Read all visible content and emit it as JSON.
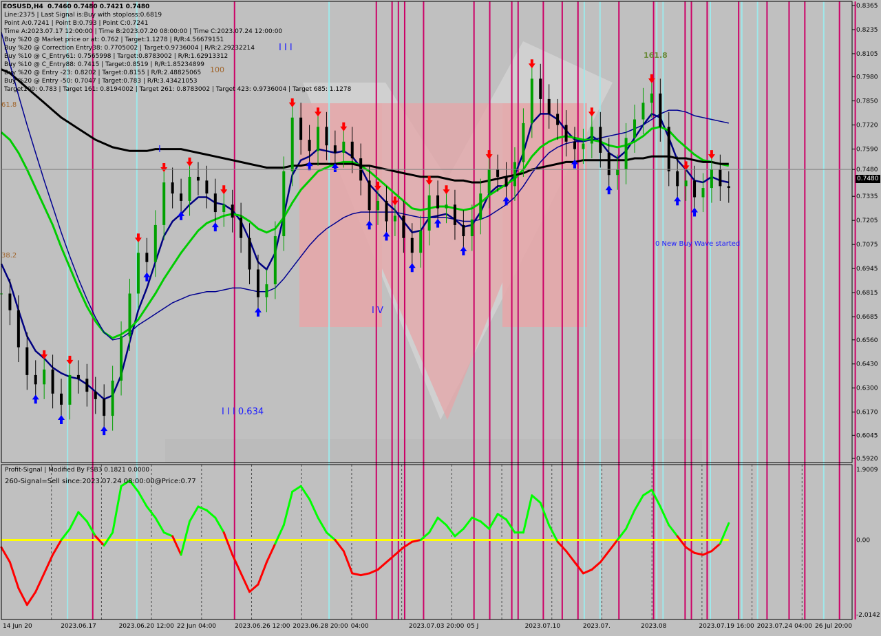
{
  "chart_data": {
    "type": "line",
    "symbol": "EOSUSD,H4",
    "ohlc": "0.7460 0.7480 0.7421 0.7480",
    "info_lines": [
      "Line:2375 | Last Signal is:Buy with stoploss:0.6819",
      "Point A:0.7241 | Point B:0.793 | Point C:0.7241",
      "Time A:2023.07.17 12:00:00 | Time B:2023.07.20 08:00:00 | Time C:2023.07.24 12:00:00",
      "Buy %20 @ Market price or at: 0.762 | Target:1.1278 | R/R:4.56679151",
      "Buy %20 @ Correction Entry38: 0.7705002 | Target:0.9736004 | R/R:2.29232214",
      "Buy %10 @ C_Entry61: 0.7565998 | Target:0.8783002 | R/R:1.62913312",
      "Buy %10 @ C_Entry88: 0.7415 | Target:0.8519 | R/R:1.85234899",
      "Buy %20 @ Entry -23: 0.8202 | Target:0.8155 | R/R:2.48825065",
      "Buy %20 @ Entry -50: 0.7047 | Target:0.783 | R/R:3.43421053",
      "Target100: 0.783 | Target 161: 0.8194002 | Target 261: 0.8783002 | Target 423: 0.9736004 | Target 685: 1.1278"
    ],
    "price_axis": {
      "ticks": [
        "0.8365",
        "0.8235",
        "0.8105",
        "0.7980",
        "0.7850",
        "0.7720",
        "0.7590",
        "0.7480",
        "0.7335",
        "0.7205",
        "0.7075",
        "0.6945",
        "0.6815",
        "0.6685",
        "0.6560",
        "0.6430",
        "0.6300",
        "0.6170",
        "0.6045",
        "0.5920"
      ],
      "min": 0.592,
      "max": 0.8365,
      "current": "0.7480"
    },
    "indicator": {
      "title": "Profit-Signal | Modified By FSB3 0.1821 0.0000",
      "signal_text": "260-Signal=Sell since:2023.07.24 08:00:00@Price:0.77",
      "axis_ticks": [
        "1.9009",
        "0.00",
        "-2.0142"
      ],
      "min": -2.0142,
      "max": 1.9009
    },
    "annotations": {
      "wave_labels": [
        "I",
        "I I I",
        "I V",
        "I I I 0.634"
      ],
      "fib_labels": [
        "61.8",
        "100",
        "38.2",
        "161.8"
      ],
      "status": "0 New Buy Wave started"
    },
    "time_labels": [
      "14 Jun 20",
      "2023.06.17",
      "2023.06.20 12:00",
      "22 Jun 04:00",
      "2023.06.26 12:00",
      "2023.06.28 20:00",
      "04:00",
      "2023.07.03 20:00",
      "05 J",
      "2023.07.10",
      "2023.07.",
      "2023.08",
      "2023.07.19 16:00",
      "2023.07.24 04:00",
      "26 Jul 20:00"
    ],
    "x_domain": [
      0,
      270
    ],
    "closes": [
      0.681,
      0.672,
      0.652,
      0.637,
      0.632,
      0.64,
      0.627,
      0.621,
      0.637,
      0.635,
      0.628,
      0.624,
      0.615,
      0.634,
      0.658,
      0.681,
      0.703,
      0.698,
      0.718,
      0.741,
      0.735,
      0.731,
      0.744,
      0.742,
      0.735,
      0.725,
      0.729,
      0.722,
      0.711,
      0.694,
      0.679,
      0.686,
      0.712,
      0.747,
      0.776,
      0.764,
      0.758,
      0.771,
      0.761,
      0.757,
      0.763,
      0.754,
      0.742,
      0.726,
      0.731,
      0.72,
      0.723,
      0.711,
      0.703,
      0.715,
      0.734,
      0.727,
      0.729,
      0.718,
      0.712,
      0.721,
      0.735,
      0.748,
      0.744,
      0.739,
      0.752,
      0.773,
      0.797,
      0.786,
      0.778,
      0.772,
      0.763,
      0.759,
      0.762,
      0.771,
      0.757,
      0.745,
      0.748,
      0.765,
      0.775,
      0.784,
      0.789,
      0.771,
      0.747,
      0.739,
      0.742,
      0.733,
      0.738,
      0.748,
      0.739,
      0.738
    ],
    "series": [
      {
        "name": "",
        "color": "#000080",
        "values": [
          0.697,
          0.687,
          0.672,
          0.658,
          0.65,
          0.646,
          0.641,
          0.638,
          0.636,
          0.635,
          0.632,
          0.628,
          0.624,
          0.626,
          0.637,
          0.655,
          0.672,
          0.684,
          0.698,
          0.712,
          0.72,
          0.724,
          0.729,
          0.733,
          0.733,
          0.73,
          0.729,
          0.726,
          0.72,
          0.71,
          0.698,
          0.694,
          0.703,
          0.723,
          0.745,
          0.753,
          0.755,
          0.759,
          0.758,
          0.757,
          0.758,
          0.755,
          0.749,
          0.74,
          0.735,
          0.73,
          0.726,
          0.72,
          0.714,
          0.715,
          0.722,
          0.723,
          0.724,
          0.721,
          0.717,
          0.718,
          0.725,
          0.735,
          0.739,
          0.739,
          0.745,
          0.757,
          0.773,
          0.778,
          0.778,
          0.775,
          0.769,
          0.764,
          0.763,
          0.766,
          0.763,
          0.757,
          0.754,
          0.758,
          0.765,
          0.772,
          0.778,
          0.776,
          0.765,
          0.753,
          0.748,
          0.742,
          0.741,
          0.744,
          0.742,
          0.741
        ]
      },
      {
        "name": "",
        "color": "#00cc00",
        "values": [
          0.768,
          0.764,
          0.757,
          0.748,
          0.738,
          0.728,
          0.718,
          0.706,
          0.695,
          0.684,
          0.674,
          0.666,
          0.66,
          0.657,
          0.659,
          0.662,
          0.667,
          0.674,
          0.681,
          0.689,
          0.696,
          0.703,
          0.709,
          0.715,
          0.719,
          0.721,
          0.723,
          0.724,
          0.723,
          0.72,
          0.716,
          0.714,
          0.716,
          0.722,
          0.73,
          0.737,
          0.742,
          0.747,
          0.749,
          0.751,
          0.752,
          0.752,
          0.75,
          0.747,
          0.743,
          0.739,
          0.735,
          0.731,
          0.727,
          0.726,
          0.727,
          0.728,
          0.728,
          0.727,
          0.726,
          0.727,
          0.73,
          0.734,
          0.737,
          0.74,
          0.743,
          0.748,
          0.755,
          0.76,
          0.763,
          0.765,
          0.766,
          0.765,
          0.764,
          0.764,
          0.763,
          0.761,
          0.76,
          0.761,
          0.763,
          0.766,
          0.77,
          0.771,
          0.769,
          0.764,
          0.76,
          0.756,
          0.753,
          0.752,
          0.751,
          0.75
        ]
      },
      {
        "name": "",
        "color": "#000000",
        "values": [
          0.802,
          0.8,
          0.796,
          0.792,
          0.788,
          0.784,
          0.78,
          0.776,
          0.773,
          0.77,
          0.767,
          0.764,
          0.762,
          0.76,
          0.759,
          0.758,
          0.758,
          0.758,
          0.759,
          0.759,
          0.759,
          0.759,
          0.758,
          0.757,
          0.756,
          0.755,
          0.754,
          0.753,
          0.752,
          0.751,
          0.75,
          0.749,
          0.749,
          0.749,
          0.75,
          0.75,
          0.751,
          0.751,
          0.751,
          0.751,
          0.751,
          0.751,
          0.75,
          0.75,
          0.749,
          0.748,
          0.747,
          0.746,
          0.745,
          0.744,
          0.744,
          0.744,
          0.743,
          0.742,
          0.742,
          0.741,
          0.741,
          0.742,
          0.743,
          0.744,
          0.745,
          0.746,
          0.748,
          0.749,
          0.75,
          0.751,
          0.752,
          0.752,
          0.753,
          0.753,
          0.753,
          0.753,
          0.753,
          0.753,
          0.754,
          0.754,
          0.755,
          0.755,
          0.755,
          0.754,
          0.754,
          0.753,
          0.752,
          0.752,
          0.751,
          0.751
        ]
      },
      {
        "name": "",
        "color": "#000090",
        "values": [
          0.822,
          0.805,
          0.788,
          0.772,
          0.757,
          0.742,
          0.728,
          0.714,
          0.701,
          0.689,
          0.678,
          0.668,
          0.66,
          0.656,
          0.657,
          0.66,
          0.664,
          0.667,
          0.67,
          0.673,
          0.676,
          0.678,
          0.68,
          0.681,
          0.682,
          0.682,
          0.683,
          0.684,
          0.684,
          0.683,
          0.682,
          0.682,
          0.684,
          0.689,
          0.695,
          0.701,
          0.707,
          0.712,
          0.716,
          0.719,
          0.722,
          0.724,
          0.725,
          0.725,
          0.725,
          0.725,
          0.725,
          0.724,
          0.723,
          0.722,
          0.722,
          0.722,
          0.722,
          0.721,
          0.72,
          0.72,
          0.721,
          0.723,
          0.726,
          0.729,
          0.733,
          0.739,
          0.746,
          0.752,
          0.757,
          0.76,
          0.762,
          0.763,
          0.763,
          0.764,
          0.765,
          0.766,
          0.767,
          0.768,
          0.77,
          0.772,
          0.775,
          0.778,
          0.78,
          0.78,
          0.779,
          0.777,
          0.776,
          0.775,
          0.774,
          0.773
        ]
      }
    ],
    "oscillator": [
      -0.2,
      -0.6,
      -1.3,
      -1.75,
      -1.4,
      -0.9,
      -0.4,
      0.0,
      0.3,
      0.75,
      0.5,
      0.1,
      -0.15,
      0.2,
      1.45,
      1.6,
      1.3,
      0.9,
      0.6,
      0.2,
      0.1,
      -0.4,
      0.5,
      0.9,
      0.8,
      0.6,
      0.2,
      -0.4,
      -0.9,
      -1.4,
      -1.2,
      -0.6,
      -0.1,
      0.4,
      1.3,
      1.45,
      1.1,
      0.6,
      0.2,
      0.0,
      -0.3,
      -0.9,
      -0.95,
      -0.9,
      -0.8,
      -0.6,
      -0.4,
      -0.2,
      -0.05,
      0.0,
      0.2,
      0.6,
      0.4,
      0.1,
      0.3,
      0.6,
      0.5,
      0.3,
      0.7,
      0.55,
      0.2,
      0.2,
      1.2,
      1.0,
      0.4,
      -0.05,
      -0.3,
      -0.6,
      -0.9,
      -0.8,
      -0.6,
      -0.3,
      0.0,
      0.3,
      0.8,
      1.2,
      1.35,
      0.9,
      0.4,
      0.1,
      -0.2,
      -0.35,
      -0.4,
      -0.3,
      -0.1,
      0.45
    ],
    "signal_line": 0.0,
    "levels": {
      "stoploss": 0.6819,
      "point_a": 0.7241,
      "point_b": 0.793,
      "point_c": 0.7241
    },
    "vertical_lines_magenta": [
      29,
      74,
      119,
      124,
      126,
      128,
      134,
      150,
      155,
      162,
      164,
      172,
      178,
      183,
      196,
      207,
      217,
      219,
      224,
      234,
      243,
      250,
      255,
      266,
      271
    ],
    "vertical_lines_cyan": [
      21,
      43,
      104,
      126,
      164,
      185,
      190,
      208,
      210,
      225,
      235,
      240,
      243,
      250,
      261
    ],
    "colors": {
      "background": "#c0c0c0",
      "bull": "#00a000",
      "bear": "#000000",
      "buy_arrow": "#0000ff",
      "sell_arrow": "#ff0000",
      "signal": "#ffff00",
      "magenta": "#cc0066",
      "cyan": "#9fe8ea",
      "grid": "#808080",
      "watermark": "#e6a6a8"
    }
  }
}
